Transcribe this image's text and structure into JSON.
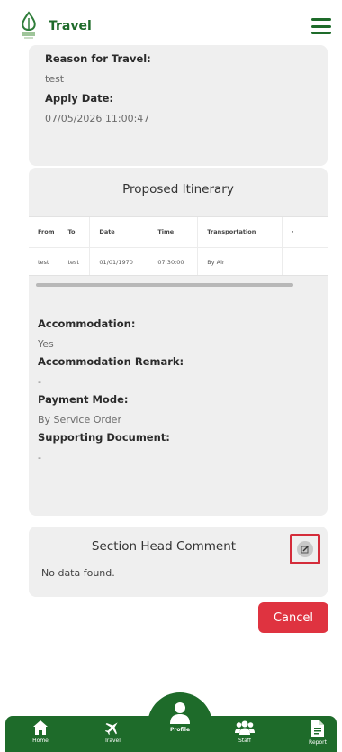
{
  "header": {
    "title": "Travel"
  },
  "travel_info": {
    "reason_label": "Reason for Travel:",
    "reason_value": "test",
    "apply_date_label": "Apply Date:",
    "apply_date_value": "07/05/2026 11:00:47"
  },
  "itinerary": {
    "title": "Proposed Itinerary",
    "columns": [
      "From",
      "To",
      "Date",
      "Time",
      "Transportation"
    ],
    "rows": [
      {
        "from": "test",
        "to": "test",
        "date": "01/01/1970",
        "time": "07:30:00",
        "transportation": "By Air"
      }
    ]
  },
  "details": {
    "accommodation_label": "Accommodation:",
    "accommodation_value": "Yes",
    "accommodation_remark_label": "Accommodation Remark:",
    "accommodation_remark_value": "-",
    "payment_mode_label": "Payment Mode:",
    "payment_mode_value": "By Service Order",
    "supporting_document_label": "Supporting Document:",
    "supporting_document_value": "-"
  },
  "comment": {
    "title": "Section Head Comment",
    "empty_text": "No data found."
  },
  "actions": {
    "cancel_label": "Cancel"
  },
  "nav": {
    "home": "Home",
    "travel": "Travel",
    "profile": "Profile",
    "staff": "Staff",
    "report": "Report"
  },
  "colors": {
    "brand": "#1e6b2a",
    "cancel": "#df3340",
    "highlight": "#d42c3a"
  }
}
